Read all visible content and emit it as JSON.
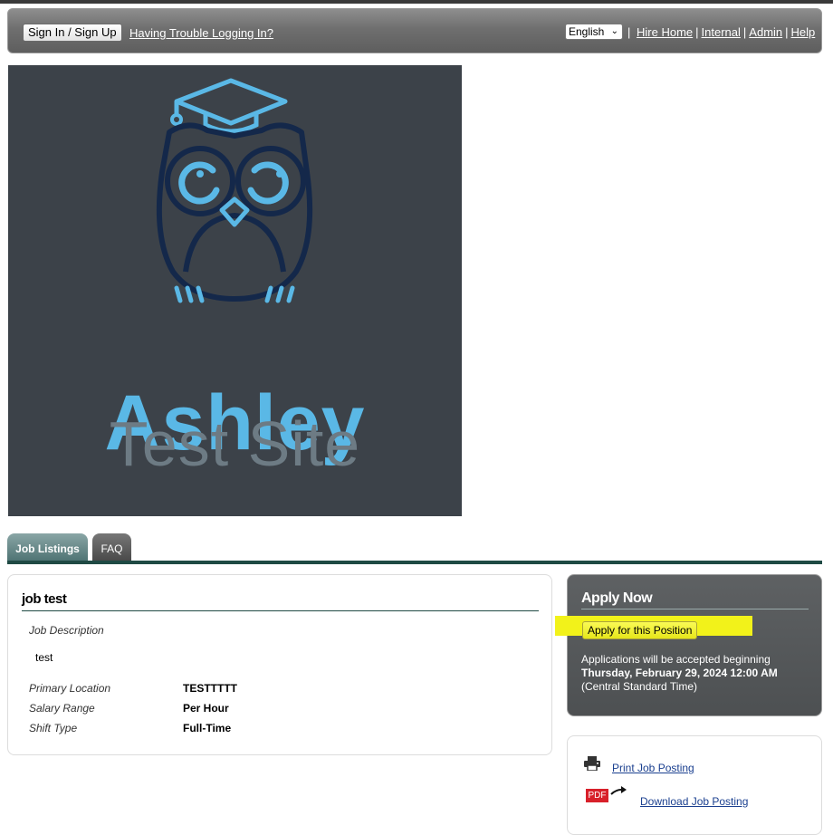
{
  "header": {
    "signin_label": "Sign In / Sign Up",
    "trouble_link": "Having Trouble Logging In?",
    "language": "English",
    "links": [
      "Hire Home",
      "Internal",
      "Admin",
      "Help"
    ],
    "separator": "|"
  },
  "logo": {
    "line1": "Ashley",
    "line2": "Test Site",
    "colors": {
      "background": "#3c4249",
      "accent": "#5ab8e6",
      "owl_outline": "#14284a"
    }
  },
  "tabs": [
    {
      "label": "Job Listings",
      "active": true
    },
    {
      "label": "FAQ",
      "active": false
    }
  ],
  "job": {
    "title": "job test",
    "description_label": "Job Description",
    "description": "test",
    "fields": [
      {
        "label": "Primary Location",
        "value": "TESTTTTT"
      },
      {
        "label": "Salary Range",
        "value": "Per Hour"
      },
      {
        "label": "Shift Type",
        "value": "Full-Time"
      }
    ]
  },
  "apply": {
    "title": "Apply Now",
    "button_label": "Apply for this Position",
    "note_line1": "Applications will be accepted beginning",
    "note_date": "Thursday, February 29, 2024 12:00 AM",
    "note_tz": "(Central Standard Time)"
  },
  "downloads": {
    "print_label": "Print Job Posting",
    "pdf_badge": "PDF",
    "download_label": "Download Job Posting"
  }
}
